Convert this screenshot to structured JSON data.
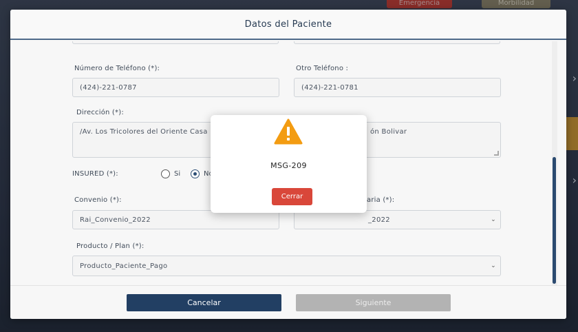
{
  "background": {
    "top_button_red": "Emergencia",
    "top_button_beige": "Morbilidad"
  },
  "modal": {
    "title": "Datos del Paciente",
    "fields": {
      "telefono_label": "Número de Teléfono (*):",
      "telefono_value": "(424)-221-0787",
      "otro_telefono_label": "Otro Teléfono :",
      "otro_telefono_value": "(424)-221-0781",
      "direccion_label": "Dirección (*):",
      "direccion_value_left": "/Av. Los Tricolores del Oriente Casa",
      "direccion_value_right": "ón Bolivar",
      "insured_label": "INSURED (*):",
      "insured_si": "Si",
      "insured_no": "No",
      "insured_selected": "No",
      "convenio_label": "Convenio (*):",
      "convenio_value": "Rai_Convenio_2022",
      "aseguradora_label_tail": "aria (*):",
      "aseguradora_value_tail": "_2022",
      "producto_label": "Producto / Plan (*):",
      "producto_value": "Producto_Paciente_Pago"
    },
    "footer": {
      "cancel_label": "Cancelar",
      "next_label": "Siguiente"
    }
  },
  "alert": {
    "icon": "warning-icon",
    "message": "MSG-209",
    "close_label": "Cerrar",
    "icon_color": "#f39c12"
  },
  "colors": {
    "primary": "#223f63",
    "danger": "#d9473a",
    "disabled": "#b3b3b3",
    "warning": "#f39c12"
  }
}
